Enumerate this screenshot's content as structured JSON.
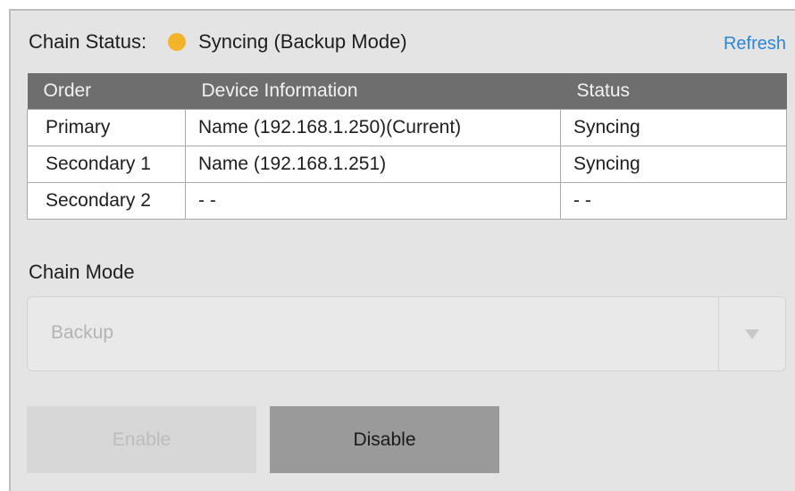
{
  "chain_status": {
    "label": "Chain Status:",
    "value": "Syncing (Backup Mode)",
    "dot_color": "#f4b42a"
  },
  "refresh": {
    "label": "Refresh",
    "color": "#2b86d6"
  },
  "table": {
    "header_bg": "#6e6e6e",
    "headers": {
      "order": "Order",
      "device": "Device Information",
      "status": "Status"
    },
    "rows": [
      {
        "order": "Primary",
        "device": "Name (192.168.1.250)(Current)",
        "status": "Syncing"
      },
      {
        "order": "Secondary 1",
        "device": "Name (192.168.1.251)",
        "status": "Syncing"
      },
      {
        "order": "Secondary 2",
        "device": "- -",
        "status": "- -"
      }
    ]
  },
  "chain_mode": {
    "label": "Chain Mode",
    "selected": "Backup",
    "icon": "chevron-down-icon"
  },
  "buttons": {
    "enable": "Enable",
    "disable": "Disable"
  }
}
